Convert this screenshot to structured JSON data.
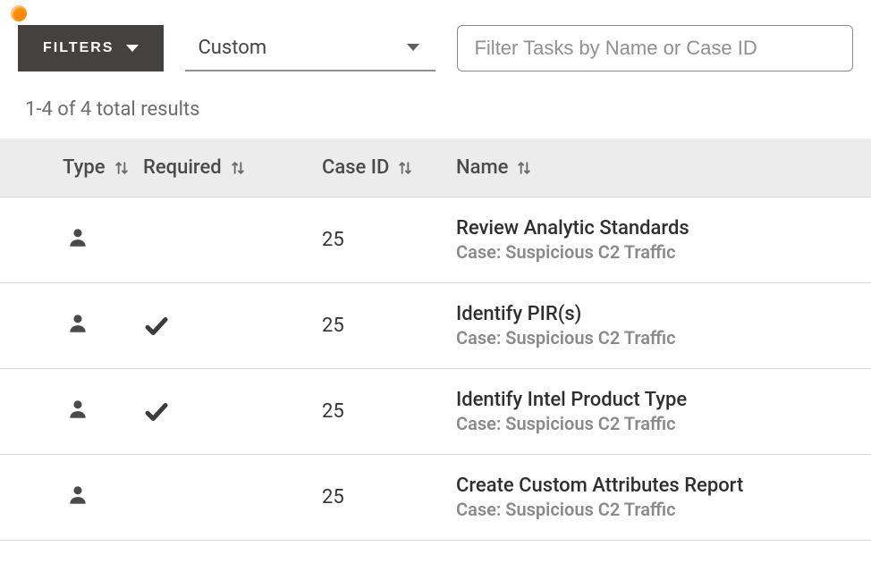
{
  "toolbar": {
    "filters_label": "FILTERS",
    "select_value": "Custom",
    "search_placeholder": "Filter Tasks by Name or Case ID"
  },
  "results_text": "1-4 of 4 total results",
  "columns": {
    "type": "Type",
    "required": "Required",
    "case_id": "Case ID",
    "name": "Name"
  },
  "rows": [
    {
      "case_id": "25",
      "required": false,
      "name": "Review Analytic Standards",
      "case_label": "Case: Suspicious C2 Traffic"
    },
    {
      "case_id": "25",
      "required": true,
      "name": "Identify PIR(s)",
      "case_label": "Case: Suspicious C2 Traffic"
    },
    {
      "case_id": "25",
      "required": true,
      "name": "Identify Intel Product Type",
      "case_label": "Case: Suspicious C2 Traffic"
    },
    {
      "case_id": "25",
      "required": false,
      "name": "Create Custom Attributes Report",
      "case_label": "Case: Suspicious C2 Traffic"
    }
  ]
}
